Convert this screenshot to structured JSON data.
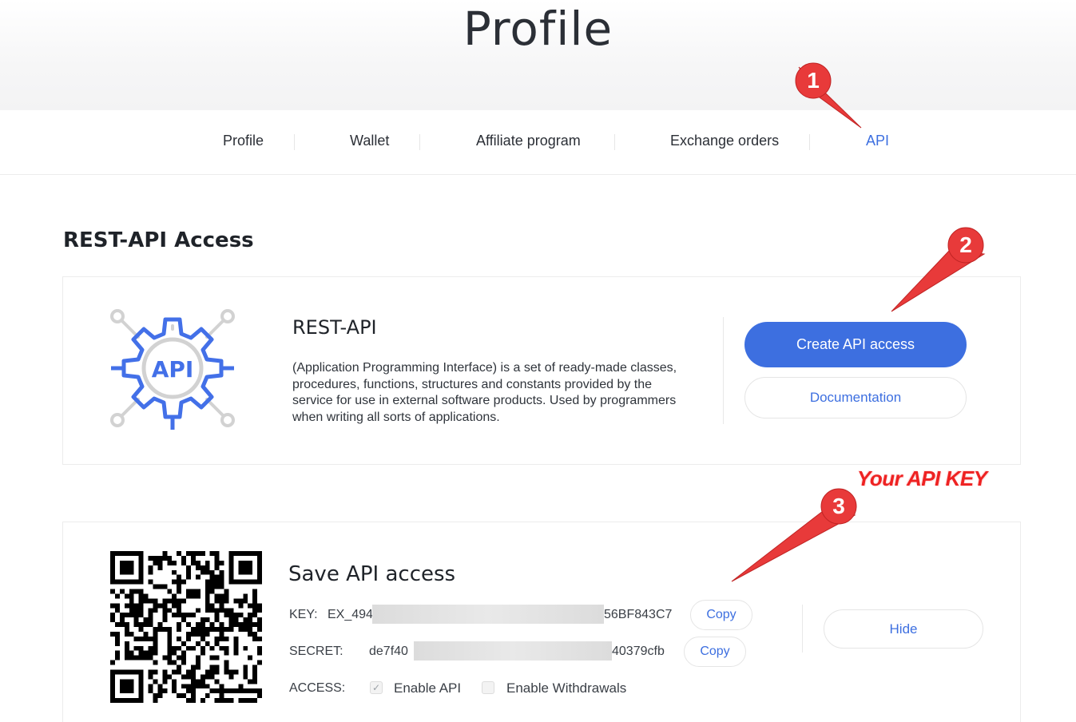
{
  "header": {
    "title": "Profile"
  },
  "nav": {
    "tabs": [
      {
        "label": "Profile"
      },
      {
        "label": "Wallet"
      },
      {
        "label": "Affiliate program"
      },
      {
        "label": "Exchange orders"
      },
      {
        "label": "API"
      }
    ],
    "active": "API"
  },
  "section": {
    "title": "REST-API Access"
  },
  "rest_card": {
    "icon_text": "API",
    "title": "REST-API",
    "description": "(Application Programming Interface) is a set of ready-made classes, procedures, functions, structures and constants provided by the service for use in external software products. Used by programmers when writing all sorts of applications.",
    "create_button": "Create API access",
    "docs_button": "Documentation"
  },
  "save_card": {
    "title": "Save API access",
    "key_label": "KEY:",
    "key_prefix": "EX_494",
    "key_suffix": "56BF843C7",
    "secret_label": "SECRET:",
    "secret_prefix": "de7f40",
    "secret_suffix": "40379cfb",
    "copy_label": "Copy",
    "access_label": "ACCESS:",
    "enable_api": {
      "label": "Enable API",
      "checked": true
    },
    "enable_withdrawals": {
      "label": "Enable Withdrawals",
      "checked": false
    },
    "hide_button": "Hide"
  },
  "annotations": {
    "markers": [
      "1",
      "2",
      "3"
    ],
    "note": "Your API KEY"
  },
  "colors": {
    "accent": "#3d6fe0",
    "annotation": "#e83a3a"
  }
}
